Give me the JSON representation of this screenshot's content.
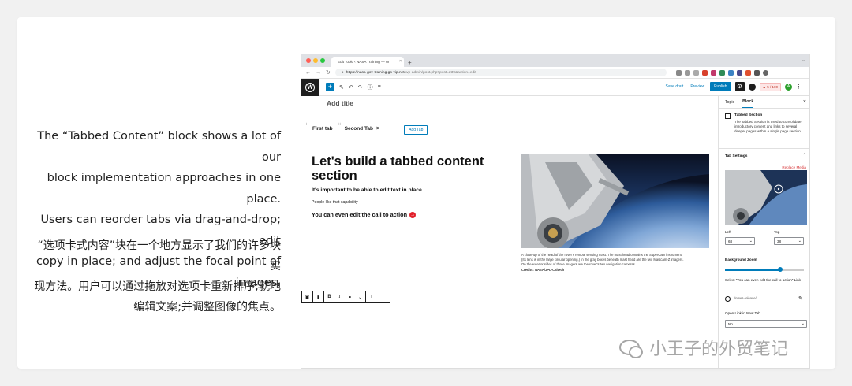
{
  "caption": {
    "en_lines": [
      "The “Tabbed Content” block shows a lot of our",
      "block implementation approaches in one place.",
      "Users can reorder tabs via drag-and-drop; edit",
      "copy in place; and adjust the focal point of",
      "images."
    ],
    "zh_lines": [
      "“选项卡式内容”块在一个地方显示了我们的许多块实",
      "现方法。用户可以通过拖放对选项卡重新排序;就地",
      "编辑文案;并调整图像的焦点。"
    ]
  },
  "watermark": "小王子的外贸笔记",
  "browser": {
    "tab_title": "Edit Topic ‹ NASA Training — W",
    "tab_close": "×",
    "new_tab": "+",
    "tab_chevron": "⌄",
    "url_host": "https://nasa-gov-training.go-vip.net",
    "url_path": "/wp-admin/post.php?post=239&action=edit",
    "nav": {
      "back": "←",
      "forward": "→",
      "reload": "↻"
    },
    "traffic_colors": [
      "#ff5f57",
      "#febc2e",
      "#28c840"
    ]
  },
  "wp_toolbar": {
    "add": "+",
    "edit": "✎",
    "undo": "↶",
    "redo": "↷",
    "info": "ⓘ",
    "list": "≡",
    "save_draft": "Save draft",
    "preview": "Preview",
    "publish": "Publish",
    "settings": "⚙",
    "score": "▲ 5 / 100",
    "avatar_letter": "A",
    "more": "⋮"
  },
  "editor": {
    "add_title": "Add title",
    "tabs": [
      {
        "label": "First tab",
        "active": true
      },
      {
        "label": "Second Tab",
        "active": false,
        "close": "×"
      }
    ],
    "drag_handle": "∷",
    "add_tab": "Add Tab",
    "heading": "Let's build a tabbed content section",
    "subheading": "It's important to be able to edit text in place",
    "paragraph": "People like that capability",
    "cta": "You can even edit the call to action",
    "cta_arrow": "→",
    "image_caption_lines": [
      "A close-up of the head of the rover's remote sensing mast. The mast head contains the SuperCam instrument.",
      "(Its lens is in the large circular opening.) In the gray boxes beneath mast head are the two Mastcam-Z imagers.",
      "On the exterior sides of those imagers are the rover's two navigation cameras."
    ],
    "image_credit": "Credits: NASA/JPL-Caltech"
  },
  "block_toolbar": {
    "block": "▣",
    "move": "▮",
    "bold": "B",
    "italic": "I",
    "link": "⚭",
    "more_rich": "⌄",
    "options": "⋮"
  },
  "sidebar": {
    "tabs": [
      "Topic",
      "Block"
    ],
    "active_tab": "Block",
    "close": "×",
    "block_name": "Tabbed Section",
    "block_desc": "The Tabbed Section is used to consolidate introductory content and links to several deeper pages within a single page section.",
    "tab_settings": "Tab Settings",
    "chev_up": "⌃",
    "replace_media": "Replace Media",
    "left_label": "Left",
    "top_label": "Top",
    "left_value": "68",
    "top_value": "38",
    "select_chev": "⌄",
    "background_zoom": "Background Zoom",
    "background_zoom_fraction": 0.7,
    "select_link_text": "Select \"You can even edit the call to action\" Link",
    "link_value": "/nmes-release/",
    "pencil": "✎",
    "open_new_tab_label": "Open Link in New Tab",
    "open_new_tab_value": "No"
  },
  "colors": {
    "wp_blue": "#007cba",
    "cta_red": "#e2202b",
    "replace_red": "#d63638"
  }
}
